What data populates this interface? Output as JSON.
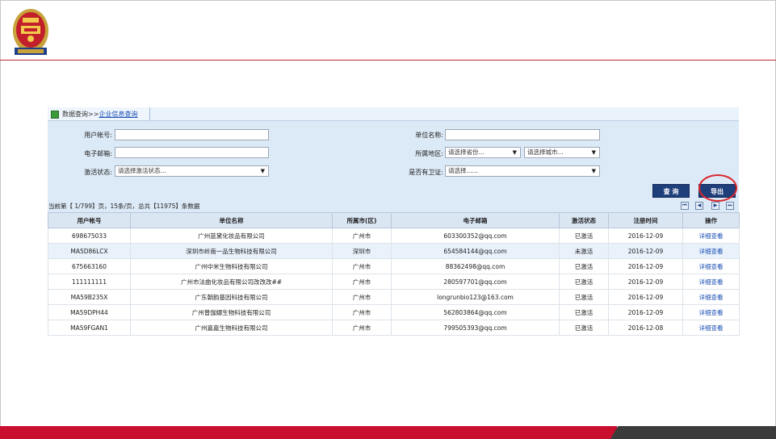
{
  "breadcrumb": {
    "root": "数据查询",
    "separator": ">>",
    "current": "企业信息查询"
  },
  "form": {
    "user_account_label": "用户帐号:",
    "unit_name_label": "单位名称:",
    "email_label": "电子邮箱:",
    "region_label": "所属地区:",
    "province_placeholder": "请选择省份...",
    "city_placeholder": "请选择城市...",
    "activation_label": "激活状态:",
    "activation_placeholder": "请选择激活状态...",
    "guard_label": "是否有卫证:",
    "guard_placeholder": "请选择......"
  },
  "buttons": {
    "query": "查 询",
    "export": "导出"
  },
  "summary": "当前第【 1/799】页，15条/页，总共【11975】条数据",
  "pager": {
    "first": "⏮",
    "prev": "◀",
    "next": "▶",
    "last": "⏭"
  },
  "table": {
    "headers": [
      "用户帐号",
      "单位名称",
      "所属市(区)",
      "电子邮箱",
      "激活状态",
      "注册时间",
      "操作"
    ],
    "rows": [
      [
        "698675033",
        "广州蓝黛化妆品有限公司",
        "广州市",
        "603300352@qq.com",
        "已激活",
        "2016-12-09",
        "详细查看"
      ],
      [
        "MA5D86LCX",
        "深圳市岭南一品生物科技有限公司",
        "深圳市",
        "654584144@qq.com",
        "未激活",
        "2016-12-09",
        "详细查看"
      ],
      [
        "675663160",
        "广州中米生物科技有限公司",
        "广州市",
        "88362498@qq.com",
        "已激活",
        "2016-12-09",
        "详细查看"
      ],
      [
        "111111111",
        "广州市法曲化妆品有限公司改改改##",
        "广州市",
        "280597701@qq.com",
        "已激活",
        "2016-12-09",
        "详细查看"
      ],
      [
        "MA59B235X",
        "广东朝韵基因科技有限公司",
        "广州市",
        "longrunbio123@163.com",
        "已激活",
        "2016-12-09",
        "详细查看"
      ],
      [
        "MA59DPH44",
        "广州普伽娜生物科技有限公司",
        "广州市",
        "562803864@qq.com",
        "已激活",
        "2016-12-09",
        "详细查看"
      ],
      [
        "MA59FGAN1",
        "广州嘉嘉生物科技有限公司",
        "广州市",
        "799505393@qq.com",
        "已激活",
        "2016-12-08",
        "详细查看"
      ]
    ]
  },
  "colors": {
    "brand_red": "#c8102e",
    "button_navy": "#1e3f7a",
    "highlight_circle": "#d9262c"
  }
}
